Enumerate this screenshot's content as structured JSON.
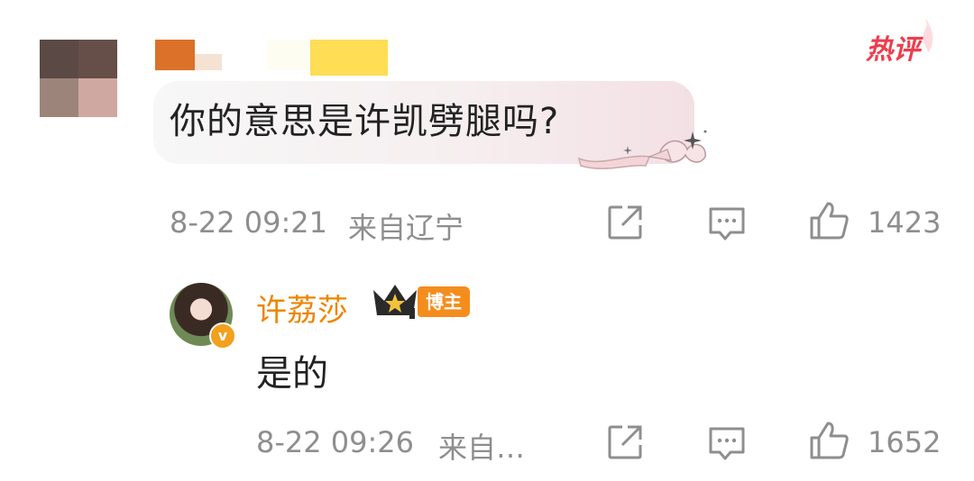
{
  "badge": {
    "hot_label": "热评"
  },
  "comment": {
    "text": "你的意思是许凯劈腿吗?",
    "timestamp": "8-22 09:21",
    "location": "来自辽宁",
    "likes": "1423"
  },
  "reply": {
    "author": "许荔莎",
    "author_tag": "博主",
    "text": "是的",
    "timestamp": "8-22 09:26",
    "location": "来自…",
    "likes": "1652"
  },
  "colors": {
    "author_name": "#f08400",
    "tag_bg": "#f58d1d",
    "hot_badge": "#ee3d4d",
    "meta_text": "#8e8e8e"
  },
  "icons": [
    "share-icon",
    "comment-icon",
    "like-icon",
    "crown-icon",
    "verified-icon",
    "bow-decoration"
  ]
}
